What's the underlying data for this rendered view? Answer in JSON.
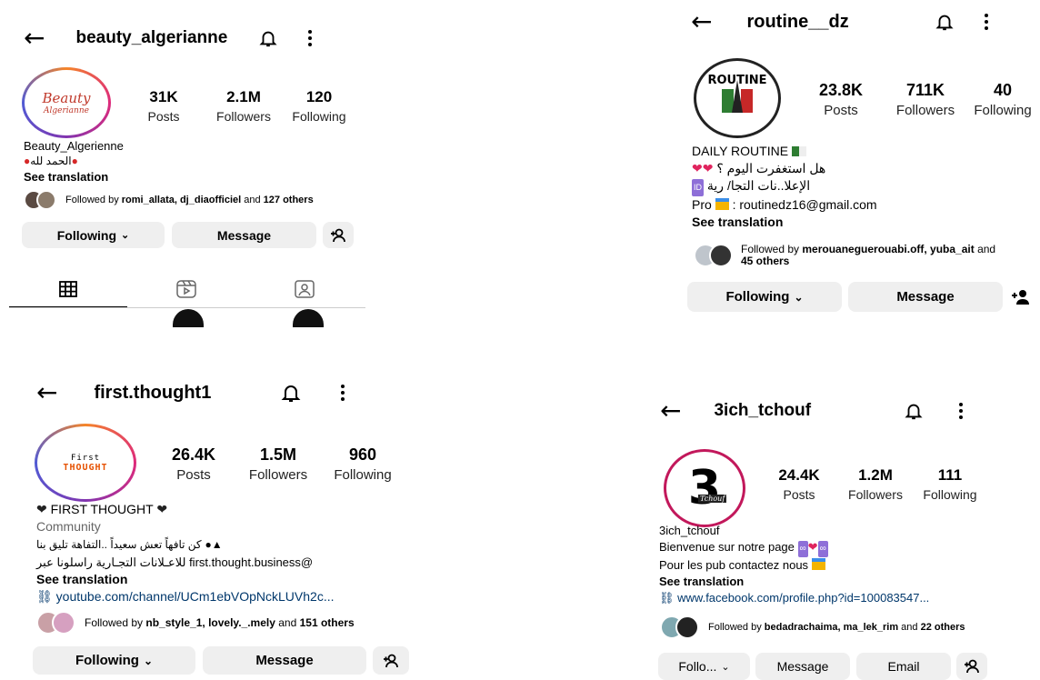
{
  "panel1": {
    "username": "beauty_algerianne",
    "avatar_text_1": "Beauty",
    "avatar_text_2": "Algerianne",
    "posts": "31K",
    "posts_label": "Posts",
    "followers": "2.1M",
    "followers_label": "Followers",
    "following": "120",
    "following_label": "Following",
    "name": "Beauty_Algerienne",
    "bio_line": "الحمد لله",
    "see_translation": "See translation",
    "followed_by_prefix": "Followed by ",
    "followed_by_names": "romi_allata, dj_diaofficiel",
    "followed_by_and": " and ",
    "followed_by_count": "127 others",
    "following_button": "Following",
    "message_button": "Message",
    "tabs": [
      "grid-icon",
      "reels-icon",
      "tagged-icon"
    ]
  },
  "panel2": {
    "username": "routine__dz",
    "avatar_text": "ROUTINE",
    "posts": "23.8K",
    "posts_label": "Posts",
    "followers": "711K",
    "followers_label": "Followers",
    "following": "40",
    "following_label": "Following",
    "name": "DAILY ROUTINE",
    "bio_line_1": "هل استغفرت اليوم ؟",
    "bio_line_2": "الإعلا..نات التجا/ رية",
    "bio_line_3_prefix": "Pro",
    "bio_line_3": ": routinedz16@gmail.com",
    "see_translation": "See translation",
    "followed_by_prefix": "Followed by ",
    "followed_by_names": "merouaneguerouabi.off, yuba_ait",
    "followed_by_and": " and",
    "followed_by_count": "45 others",
    "following_button": "Following",
    "message_button": "Message"
  },
  "panel3": {
    "username": "first.thought1",
    "avatar_text_1": "First",
    "avatar_text_2": "THOUGHT",
    "posts": "26.4K",
    "posts_label": "Posts",
    "followers": "1.5M",
    "followers_label": "Followers",
    "following": "960",
    "following_label": "Following",
    "name": "FIRST THOUGHT",
    "category": "Community",
    "bio_line_1": "كن تافهاً تعش سعيداً ..التفاهة تليق بنا",
    "bio_line_2": "@first.thought.business للاعـلانات التجـارية راسلونا عبر",
    "see_translation": "See translation",
    "link": "youtube.com/channel/UCm1ebVOpNckLUVh2c...",
    "followed_by_prefix": "Followed by ",
    "followed_by_names": "nb_style_1, lovely._.mely",
    "followed_by_and": " and ",
    "followed_by_count": "151 others",
    "following_button": "Following",
    "message_button": "Message"
  },
  "panel4": {
    "username": "3ich_tchouf",
    "avatar_text_1": "3",
    "avatar_text_2": "Tchouf",
    "posts": "24.4K",
    "posts_label": "Posts",
    "followers": "1.2M",
    "followers_label": "Followers",
    "following": "111",
    "following_label": "Following",
    "name": "3ich_tchouf",
    "bio_line_1": "Bienvenue sur notre page",
    "bio_line_2": "Pour les pub contactez nous",
    "see_translation": "See translation",
    "link": "www.facebook.com/profile.php?id=100083547...",
    "followed_by_prefix": "Followed by ",
    "followed_by_names": "bedadrachaima, ma_lek_rim",
    "followed_by_and": " and ",
    "followed_by_count": "22 others",
    "following_button": "Follo...",
    "message_button": "Message",
    "email_button": "Email"
  },
  "colors": {
    "button_bg": "#efefef",
    "link": "#00376b",
    "heart_red": "#e0245e"
  }
}
